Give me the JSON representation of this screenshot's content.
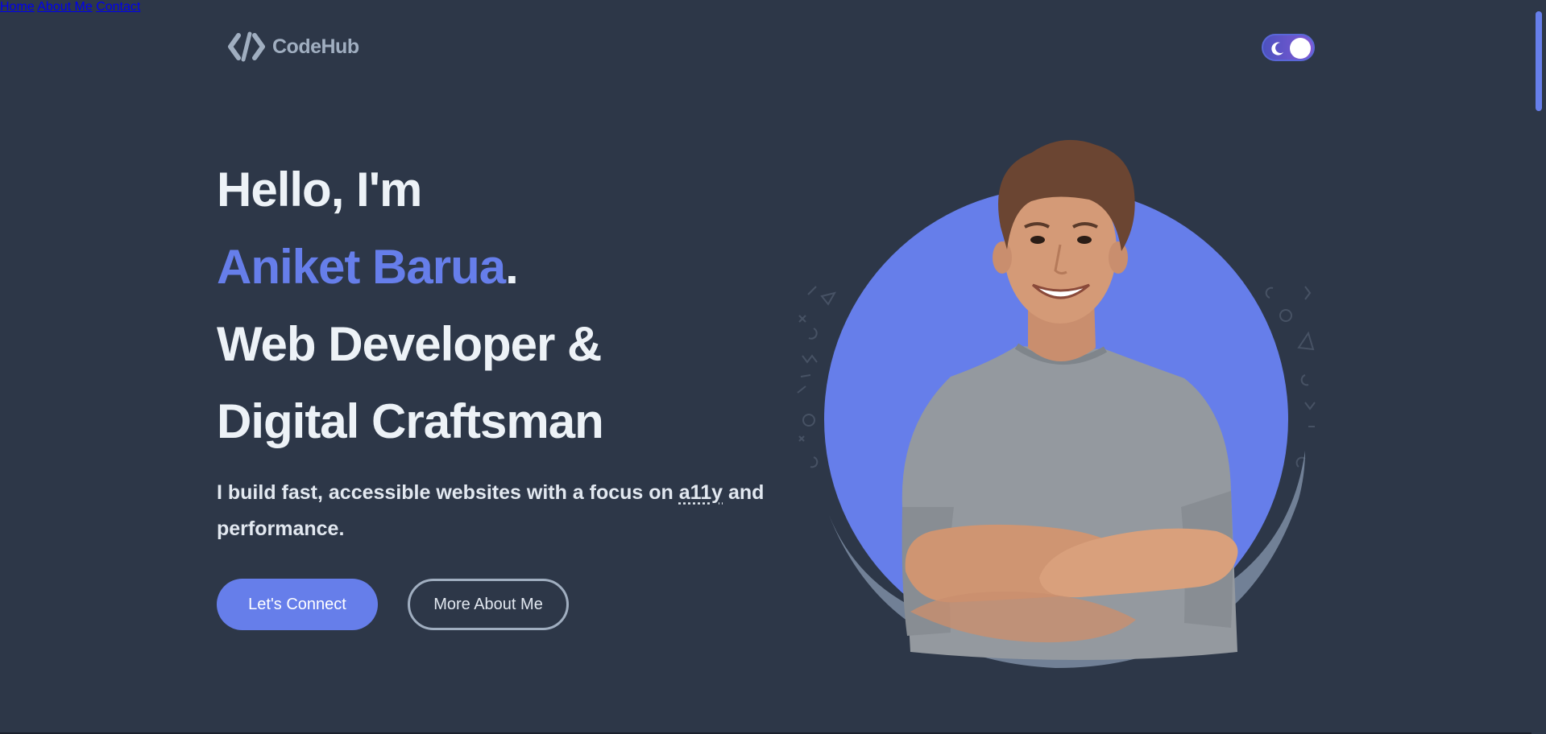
{
  "brand": {
    "name": "CodeHub"
  },
  "nav": {
    "items": [
      {
        "label": "Home"
      },
      {
        "label": "About Me"
      },
      {
        "label": "Contact"
      }
    ]
  },
  "theme_toggle": {
    "state": "dark",
    "icon": "moon-icon"
  },
  "hero": {
    "greeting": "Hello, I'm",
    "name": "Aniket Barua",
    "name_suffix": ".",
    "title_line1": "Web Developer &",
    "title_line2": "Digital Craftsman",
    "subtitle_pre": "I build fast, accessible websites with a focus on ",
    "subtitle_abbr": "a11y",
    "subtitle_post": " and performance.",
    "primary_button": "Let's Connect",
    "secondary_button": "More About Me"
  },
  "colors": {
    "background": "#2d3748",
    "accent": "#667eea",
    "text": "#edf2f7",
    "muted": "#a0aec0"
  }
}
